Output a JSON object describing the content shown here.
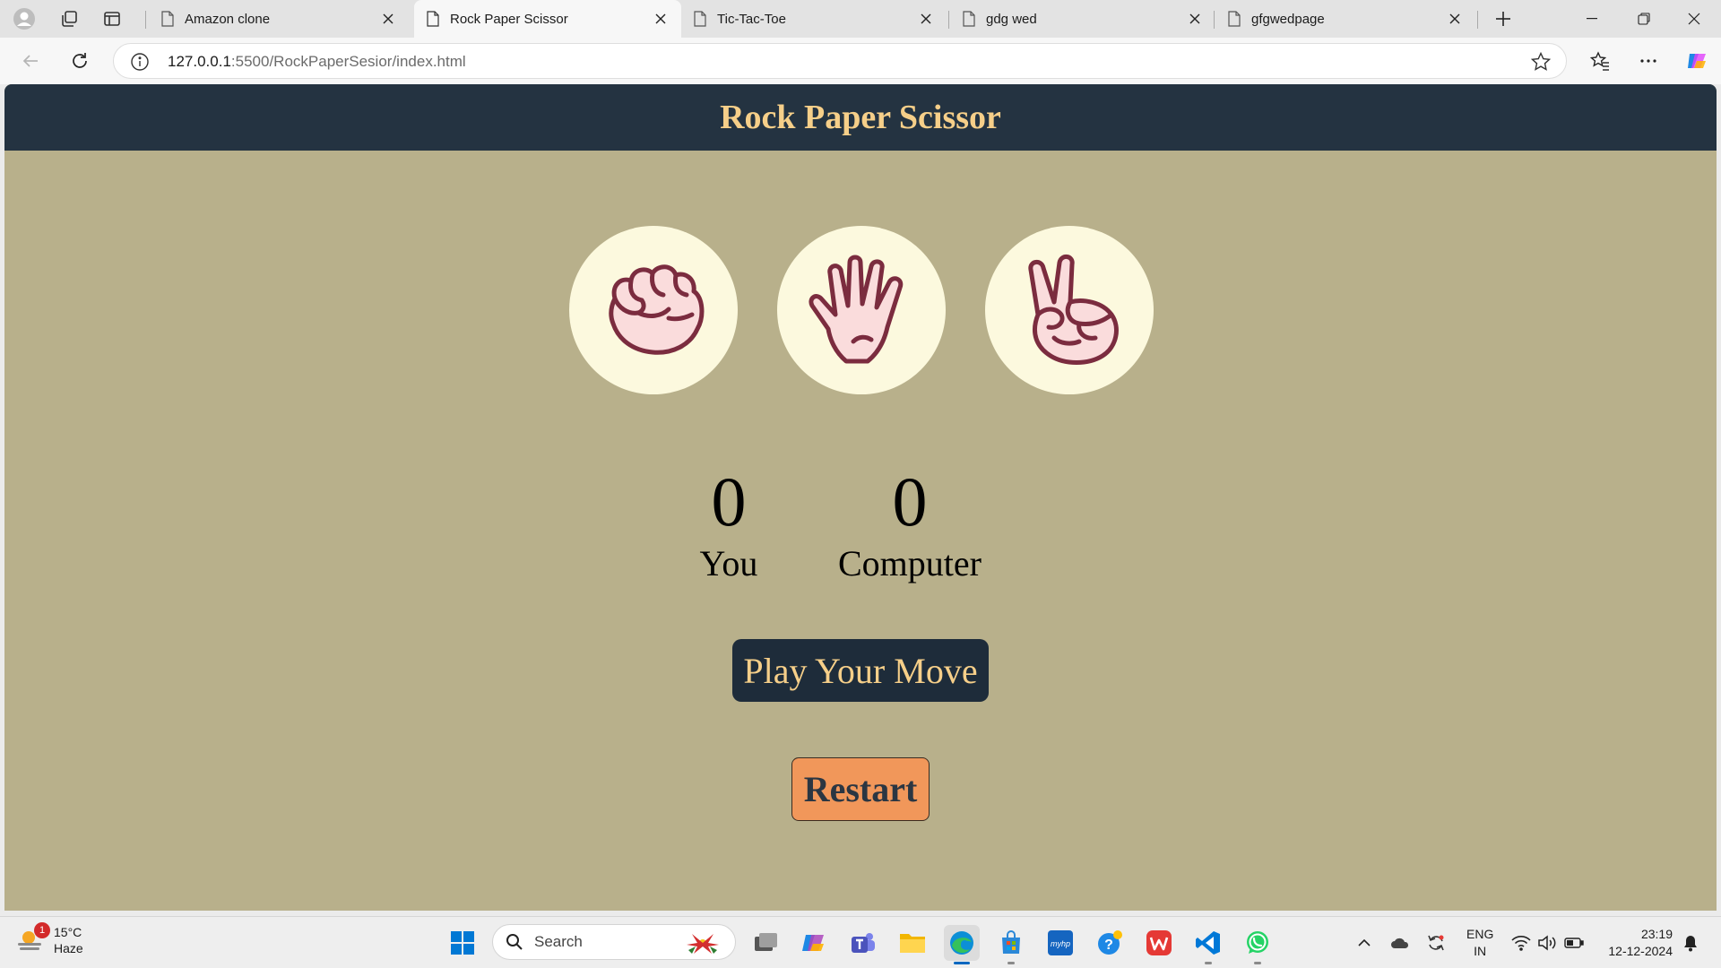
{
  "browser": {
    "tabs": [
      {
        "title": "Amazon clone",
        "active": false
      },
      {
        "title": "Rock Paper Scissor",
        "active": true
      },
      {
        "title": "Tic-Tac-Toe",
        "active": false
      },
      {
        "title": "gdg wed",
        "active": false
      },
      {
        "title": "gfgwedpage",
        "active": false
      }
    ],
    "url_host": "127.0.0.1",
    "url_rest": ":5500/RockPaperSesior/index.html"
  },
  "page": {
    "title": "Rock Paper Scissor",
    "choices": [
      {
        "name": "rock",
        "icon": "fist-icon"
      },
      {
        "name": "paper",
        "icon": "open-hand-icon"
      },
      {
        "name": "scissors",
        "icon": "peace-hand-icon"
      }
    ],
    "scores": {
      "user": {
        "value": "0",
        "label": "You"
      },
      "computer": {
        "value": "0",
        "label": "Computer"
      }
    },
    "message": "Play Your Move",
    "restart_label": "Restart",
    "colors": {
      "header_bg": "#243341",
      "title_color": "#f6cf89",
      "page_bg": "#b8b08b",
      "choice_bg": "#fcf9de",
      "message_bg": "#1e2c3a",
      "restart_bg": "#f1975a"
    }
  },
  "taskbar": {
    "weather": {
      "temp": "15°C",
      "condition": "Haze",
      "badge": "1"
    },
    "search_placeholder": "Search",
    "lang_top": "ENG",
    "lang_bottom": "IN",
    "time": "23:19",
    "date": "12-12-2024"
  }
}
